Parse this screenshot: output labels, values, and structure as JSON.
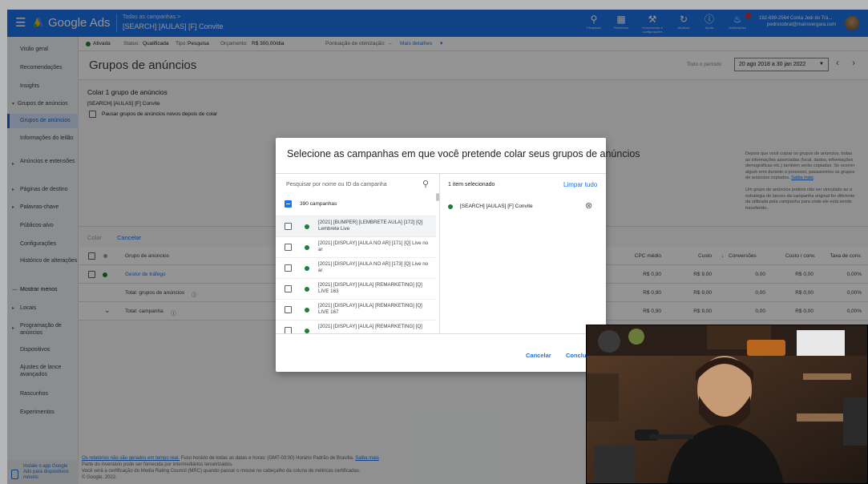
{
  "app": {
    "brand": "Google Ads",
    "crumb_parent": "Todas as campanhas  >",
    "crumb_current": "[SEARCH] [AULAS] [F] Convite",
    "tools": [
      {
        "icon": "search-icon",
        "label": "Pesquisar"
      },
      {
        "icon": "reports-icon",
        "label": "Relatórios"
      },
      {
        "icon": "wrench-icon",
        "label": "Ferramentas e configurações"
      },
      {
        "icon": "refresh-icon",
        "label": "Atualizar"
      },
      {
        "icon": "help-icon",
        "label": "Ajuda"
      },
      {
        "icon": "bell-icon",
        "label": "Notificações"
      }
    ],
    "account_line1": "182-699-2564 Conta Jedi do Trá...",
    "account_line2": "pedrosobral@mairovergara.com"
  },
  "sidebar": {
    "items": [
      {
        "label": "Visão geral"
      },
      {
        "label": "Recomendações"
      },
      {
        "label": "Insights"
      },
      {
        "label": "Grupos de anúncios"
      },
      {
        "label": "Grupos de anúncios"
      },
      {
        "label": "Informações do leilão"
      },
      {
        "label": "Anúncios e extensões"
      },
      {
        "label": "Páginas de destino"
      },
      {
        "label": "Palavras-chave"
      },
      {
        "label": "Públicos-alvo"
      },
      {
        "label": "Configurações"
      },
      {
        "label": "Histórico de alterações"
      },
      {
        "label": "Mostrar menos"
      },
      {
        "label": "Locais"
      },
      {
        "label": "Programação de anúncios"
      },
      {
        "label": "Dispositivos"
      },
      {
        "label": "Ajustes de lance avançados"
      },
      {
        "label": "Rascunhos"
      },
      {
        "label": "Experimentos"
      }
    ],
    "app_promo": "Instale o app Google Ads para dispositivos móveis"
  },
  "status": {
    "state": "Ativada",
    "status_label": "Status:",
    "status_value": "Qualificada",
    "type_label": "Tipo:",
    "type_value": "Pesquisa",
    "budget_label": "Orçamento:",
    "budget_value": "R$ 300,00/dia",
    "score_label": "Pontuação de otimização:",
    "score_value": "–",
    "more": "Mais detalhes"
  },
  "page": {
    "title": "Grupos de anúncios",
    "period_label": "Todo o período",
    "date_range": "20 ago 2018 a 30 jan 2022"
  },
  "paste": {
    "heading": "Colar 1 grupo de anúncios",
    "source": "[SEARCH] [AULAS] [F] Convite",
    "pause_label": "Pausar grupos de anúncios novos depois de colar",
    "info1_text": "Depois que você copiar os grupos de anúncios, todas as informações associadas (local, dados, informações demográficas etc.) também serão copiadas. Se ocorrer algum erro durante o processo, pausaremos os grupos de anúncios copiados.",
    "info1_link": "Saiba mais",
    "info2": "Um grupo de anúncios poderá não ser vinculado ao a estratégia de lances da campanha original for diferente da utilizada pela campanha para onde ele está sendo transferido.",
    "paste_btn": "Colar",
    "cancel_btn": "Cancelar"
  },
  "table": {
    "headers": {
      "name": "Grupo de anúncios",
      "cpc": "CPC médio",
      "cost": "Custo",
      "conv": "Conversões",
      "cpa": "Custo / conv.",
      "rate": "Taxa de conv."
    },
    "rows": [
      {
        "name": "Gestor de tráfego",
        "cpc": "R$ 0,90",
        "cost": "R$ 9,00",
        "conv": "0,00",
        "cpa": "R$ 0,00",
        "rate": "0,00%"
      }
    ],
    "total_groups": {
      "label": "Total: grupos de anúncios",
      "cpc": "R$ 0,90",
      "cost": "R$ 9,00",
      "conv": "0,00",
      "cpa": "R$ 0,00",
      "rate": "0,00%"
    },
    "total_campaign": {
      "label": "Total: campanha",
      "cpc": "R$ 0,90",
      "cost": "R$ 9,00",
      "conv": "0,00",
      "cpa": "R$ 0,00",
      "rate": "0,00%"
    }
  },
  "footer": {
    "line1_link": "Os relatórios não são gerados em tempo real.",
    "line1_text": " Fuso horário de todas as datas e horas: (GMT-03:00) Horário Padrão de Brasília.",
    "line1_link2": "Saiba mais",
    "line2": "Parte do inventário pode ser fornecida por intermediários terceirizados.",
    "line3": "Você verá a certificação do Media Rating Council (MRC) quando passar o mouse no cabeçalho da coluna de métricas certificadas.",
    "line4": "© Google, 2022."
  },
  "modal": {
    "title": "Selecione as campanhas em que você pretende colar seus grupos de anúncios",
    "search_placeholder": "Pesquisar por nome ou ID da campanha",
    "all_label": "390 campanhas",
    "campaigns": [
      "[2021] [BUMPER] [LEMBRETE AULA] [172] [Q] Lembrete Live",
      "[2021] [DISPLAY] [AULA NO AR] [171] [Q] Live no ar",
      "[2021] [DISPLAY] [AULA NO AR] [173] [Q] Live no ar",
      "[2021] [DISPLAY] [AULA] [REMARKETING] [Q] LIVE 163",
      "[2021] [DISPLAY] [AULA] [REMARKETING] [Q] LIVE 167",
      "[2021] [DISPLAY] [AULA] [REMARKETING] [Q]"
    ],
    "selected_count": "1 item selecionado",
    "clear_all": "Limpar tudo",
    "selected_items": [
      "[SEARCH] [AULAS] [F] Convite"
    ],
    "cancel": "Cancelar",
    "confirm": "Conclu"
  },
  "colors": {
    "primary": "#1a73e8",
    "active_green": "#188038",
    "nav_selected_bg": "#d2e3fc"
  }
}
